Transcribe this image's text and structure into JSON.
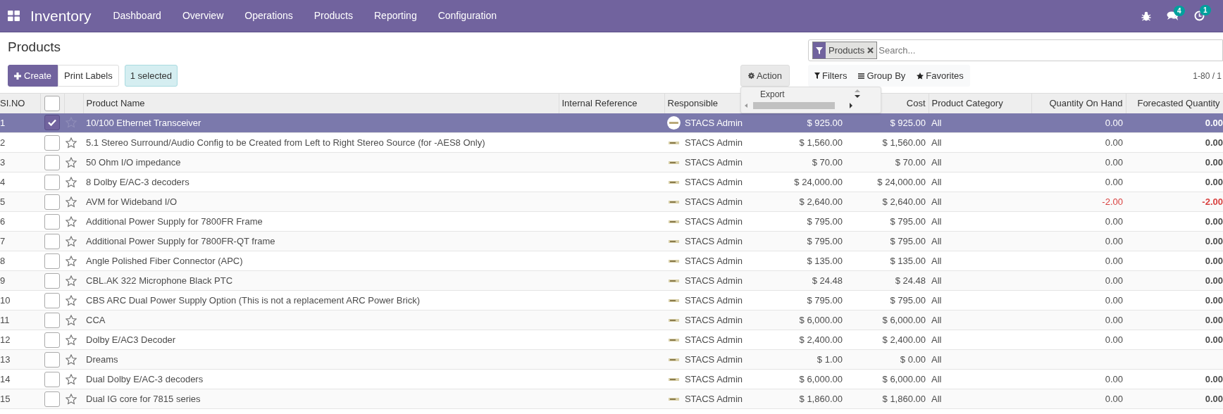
{
  "navbar": {
    "app": "Inventory",
    "menu": [
      "Dashboard",
      "Overview",
      "Operations",
      "Products",
      "Reporting",
      "Configuration"
    ],
    "messages_badge": "4",
    "activities_badge": "1"
  },
  "title": "Products",
  "buttons": {
    "create": "Create",
    "print": "Print Labels",
    "selection": "1 selected",
    "action": "Action"
  },
  "action_menu": {
    "open": true,
    "items": [
      "Export"
    ]
  },
  "search": {
    "facet": "Products",
    "placeholder": "Search..."
  },
  "search_options": [
    "Filters",
    "Group By",
    "Favorites"
  ],
  "pager": "1-80 / 1",
  "table": {
    "columns": [
      {
        "kind": "text",
        "label": "SI.NO"
      },
      {
        "kind": "select",
        "checked": false
      },
      {
        "kind": "blank"
      },
      {
        "kind": "text",
        "label": "Product Name"
      },
      {
        "kind": "text",
        "label": "Internal Reference"
      },
      {
        "kind": "text",
        "label": "Responsible"
      },
      {
        "kind": "blank"
      },
      {
        "kind": "text",
        "label": "Cost"
      },
      {
        "kind": "text",
        "label": "Product Category"
      },
      {
        "kind": "text",
        "label": "Quantity On Hand"
      },
      {
        "kind": "text",
        "label": "Forecasted Quantity"
      }
    ],
    "rows": [
      {
        "no": "1",
        "selected": true,
        "starred": false,
        "name": "10/100 Ethernet Transceiver",
        "responsible": "STACS Admin",
        "price": "$ 925.00",
        "cost": "$ 925.00",
        "category": "All",
        "on_hand": "0.00",
        "forecast": "0.00",
        "negative": false
      },
      {
        "no": "2",
        "selected": false,
        "starred": false,
        "name": "5.1 Stereo Surround/Audio Config to be Created from Left to Right Stereo Source (for -AES8 Only)",
        "responsible": "STACS Admin",
        "price": "$ 1,560.00",
        "cost": "$ 1,560.00",
        "category": "All",
        "on_hand": "0.00",
        "forecast": "0.00",
        "negative": false
      },
      {
        "no": "3",
        "selected": false,
        "starred": false,
        "name": "50 Ohm I/O impedance",
        "responsible": "STACS Admin",
        "price": "$ 70.00",
        "cost": "$ 70.00",
        "category": "All",
        "on_hand": "0.00",
        "forecast": "0.00",
        "negative": false
      },
      {
        "no": "4",
        "selected": false,
        "starred": false,
        "name": "8 Dolby E/AC-3 decoders",
        "responsible": "STACS Admin",
        "price": "$ 24,000.00",
        "cost": "$ 24,000.00",
        "category": "All",
        "on_hand": "0.00",
        "forecast": "0.00",
        "negative": false
      },
      {
        "no": "5",
        "selected": false,
        "starred": false,
        "name": "AVM for Wideband I/O",
        "responsible": "STACS Admin",
        "price": "$ 2,640.00",
        "cost": "$ 2,640.00",
        "category": "All",
        "on_hand": "-2.00",
        "forecast": "-2.00",
        "negative": true
      },
      {
        "no": "6",
        "selected": false,
        "starred": false,
        "name": "Additional Power Supply for 7800FR Frame",
        "responsible": "STACS Admin",
        "price": "$ 795.00",
        "cost": "$ 795.00",
        "category": "All",
        "on_hand": "0.00",
        "forecast": "0.00",
        "negative": false
      },
      {
        "no": "7",
        "selected": false,
        "starred": false,
        "name": "Additional Power Supply for 7800FR-QT frame",
        "responsible": "STACS Admin",
        "price": "$ 795.00",
        "cost": "$ 795.00",
        "category": "All",
        "on_hand": "0.00",
        "forecast": "0.00",
        "negative": false
      },
      {
        "no": "8",
        "selected": false,
        "starred": false,
        "name": "Angle Polished Fiber Connector (APC)",
        "responsible": "STACS Admin",
        "price": "$ 135.00",
        "cost": "$ 135.00",
        "category": "All",
        "on_hand": "0.00",
        "forecast": "0.00",
        "negative": false
      },
      {
        "no": "9",
        "selected": false,
        "starred": false,
        "name": "CBL.AK 322 Microphone Black PTC",
        "responsible": "STACS Admin",
        "price": "$ 24.48",
        "cost": "$ 24.48",
        "category": "All",
        "on_hand": "0.00",
        "forecast": "0.00",
        "negative": false
      },
      {
        "no": "10",
        "selected": false,
        "starred": false,
        "name": "CBS ARC Dual Power Supply Option (This is not a replacement ARC Power Brick)",
        "responsible": "STACS Admin",
        "price": "$ 795.00",
        "cost": "$ 795.00",
        "category": "All",
        "on_hand": "0.00",
        "forecast": "0.00",
        "negative": false
      },
      {
        "no": "11",
        "selected": false,
        "starred": false,
        "name": "CCA",
        "responsible": "STACS Admin",
        "price": "$ 6,000.00",
        "cost": "$ 6,000.00",
        "category": "All",
        "on_hand": "0.00",
        "forecast": "0.00",
        "negative": false
      },
      {
        "no": "12",
        "selected": false,
        "starred": false,
        "name": "Dolby E/AC3 Decoder",
        "responsible": "STACS Admin",
        "price": "$ 2,400.00",
        "cost": "$ 2,400.00",
        "category": "All",
        "on_hand": "0.00",
        "forecast": "0.00",
        "negative": false
      },
      {
        "no": "13",
        "selected": false,
        "starred": false,
        "name": "Dreams",
        "responsible": "STACS Admin",
        "price": "$ 1.00",
        "cost": "$ 0.00",
        "category": "All",
        "negative": false
      },
      {
        "no": "14",
        "selected": false,
        "starred": false,
        "name": "Dual Dolby E/AC-3 decoders",
        "responsible": "STACS Admin",
        "price": "$ 6,000.00",
        "cost": "$ 6,000.00",
        "category": "All",
        "on_hand": "0.00",
        "forecast": "0.00",
        "negative": false
      },
      {
        "no": "15",
        "selected": false,
        "starred": false,
        "name": "Dual IG core for 7815 series",
        "responsible": "STACS Admin",
        "price": "$ 1,860.00",
        "cost": "$ 1,860.00",
        "category": "All",
        "on_hand": "0.00",
        "forecast": "0.00",
        "negative": false
      }
    ]
  }
}
